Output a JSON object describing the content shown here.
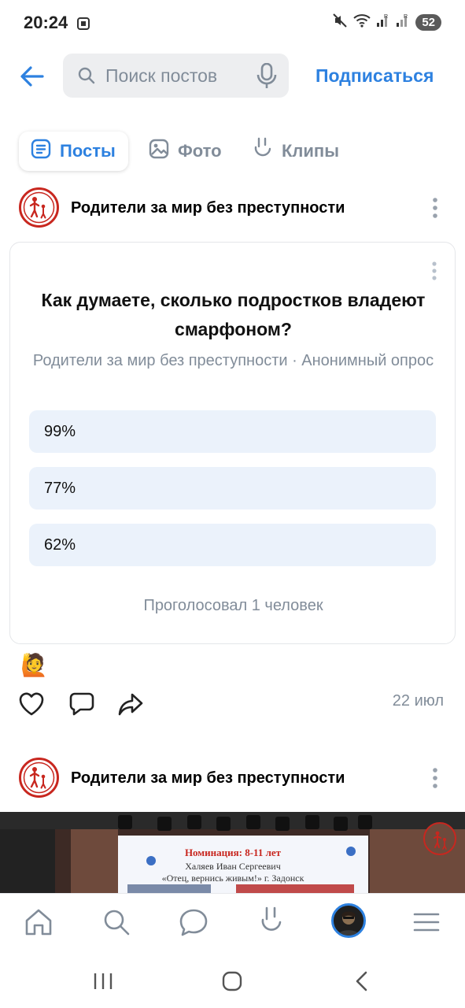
{
  "status_bar": {
    "time": "20:24",
    "battery": "52"
  },
  "header": {
    "search_placeholder": "Поиск постов",
    "subscribe_label": "Подписаться"
  },
  "tabs": [
    {
      "label": "Посты",
      "active": true
    },
    {
      "label": "Фото",
      "active": false
    },
    {
      "label": "Клипы",
      "active": false
    }
  ],
  "posts": [
    {
      "author": "Родители за мир без преступности",
      "poll": {
        "question": "Как думаете, сколько подростков владеют смарфоном?",
        "meta": "Родители за мир без преступности · Анонимный опрос",
        "options": [
          "99%",
          "77%",
          "62%"
        ],
        "votes": "Проголосовал 1 человек"
      },
      "reaction_emoji": "🙋",
      "date": "22 июл"
    },
    {
      "author": "Родители за мир без преступности",
      "photo_text": {
        "line1": "Номинация: 8-11 лет",
        "line2": "Халяев Иван Сергеевич",
        "line3": "«Отец, вернись живым!» г. Задонск"
      }
    }
  ],
  "colors": {
    "accent": "#2d81e0",
    "secondary_text": "#818c99",
    "poll_option_bg": "#ebf2fb",
    "logo_red": "#c8271f"
  },
  "icons": {
    "bottom_nav": [
      "home-icon",
      "search-icon",
      "messages-icon",
      "clips-icon",
      "profile-avatar",
      "menu-icon"
    ],
    "actions": [
      "like-icon",
      "comment-icon",
      "share-icon"
    ]
  }
}
